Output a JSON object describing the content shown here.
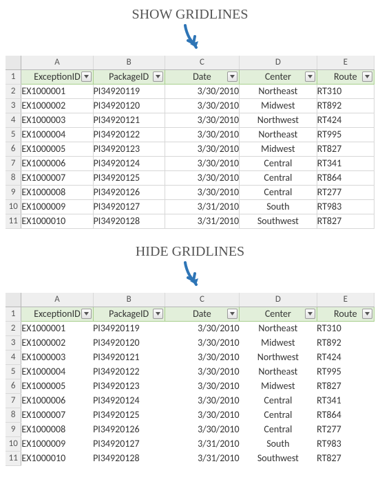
{
  "captions": {
    "show": "SHOW GRIDLINES",
    "hide": "HIDE GRIDLINES"
  },
  "arrow_color": "#2e75b6",
  "columns": [
    "A",
    "B",
    "C",
    "D",
    "E"
  ],
  "header_labels": {
    "A": "ExceptionID",
    "B": "PackageID",
    "C": "Date",
    "D": "Center",
    "E": "Route"
  },
  "row_numbers": [
    "1",
    "2",
    "3",
    "4",
    "5",
    "6",
    "7",
    "8",
    "9",
    "10",
    "11"
  ],
  "rows": [
    {
      "A": "EX1000001",
      "B": "PI34920119",
      "C": "3/30/2010",
      "D": "Northeast",
      "E": "RT310"
    },
    {
      "A": "EX1000002",
      "B": "PI34920120",
      "C": "3/30/2010",
      "D": "Midwest",
      "E": "RT892"
    },
    {
      "A": "EX1000003",
      "B": "PI34920121",
      "C": "3/30/2010",
      "D": "Northwest",
      "E": "RT424"
    },
    {
      "A": "EX1000004",
      "B": "PI34920122",
      "C": "3/30/2010",
      "D": "Northeast",
      "E": "RT995"
    },
    {
      "A": "EX1000005",
      "B": "PI34920123",
      "C": "3/30/2010",
      "D": "Midwest",
      "E": "RT827"
    },
    {
      "A": "EX1000006",
      "B": "PI34920124",
      "C": "3/30/2010",
      "D": "Central",
      "E": "RT341"
    },
    {
      "A": "EX1000007",
      "B": "PI34920125",
      "C": "3/30/2010",
      "D": "Central",
      "E": "RT864"
    },
    {
      "A": "EX1000008",
      "B": "PI34920126",
      "C": "3/30/2010",
      "D": "Central",
      "E": "RT277"
    },
    {
      "A": "EX1000009",
      "B": "PI34920127",
      "C": "3/31/2010",
      "D": "South",
      "E": "RT983"
    },
    {
      "A": "EX1000010",
      "B": "PI34920128",
      "C": "3/31/2010",
      "D": "Southwest",
      "E": "RT827"
    }
  ],
  "column_align": {
    "A": "left",
    "B": "left",
    "C": "right",
    "D": "center",
    "E": "left"
  }
}
